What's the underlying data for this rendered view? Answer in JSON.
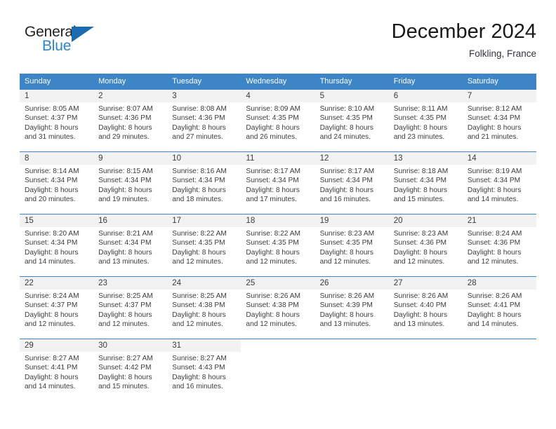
{
  "brand": {
    "name_part1": "General",
    "name_part2": "Blue",
    "triangle_icon": "triangle-icon",
    "color_dark": "#231f20",
    "color_blue": "#2a86c8"
  },
  "header": {
    "title": "December 2024",
    "subtitle": "Folkling, France"
  },
  "theme": {
    "header_bg": "#3d85c6",
    "daynum_bg": "#f2f2f2",
    "text": "#3c3c3c"
  },
  "weekdays": [
    "Sunday",
    "Monday",
    "Tuesday",
    "Wednesday",
    "Thursday",
    "Friday",
    "Saturday"
  ],
  "labels": {
    "sunrise": "Sunrise:",
    "sunset": "Sunset:",
    "daylight": "Daylight:"
  },
  "weeks": [
    [
      {
        "day": "1",
        "sunrise": "Sunrise: 8:05 AM",
        "sunset": "Sunset: 4:37 PM",
        "daylight1": "Daylight: 8 hours",
        "daylight2": "and 31 minutes."
      },
      {
        "day": "2",
        "sunrise": "Sunrise: 8:07 AM",
        "sunset": "Sunset: 4:36 PM",
        "daylight1": "Daylight: 8 hours",
        "daylight2": "and 29 minutes."
      },
      {
        "day": "3",
        "sunrise": "Sunrise: 8:08 AM",
        "sunset": "Sunset: 4:36 PM",
        "daylight1": "Daylight: 8 hours",
        "daylight2": "and 27 minutes."
      },
      {
        "day": "4",
        "sunrise": "Sunrise: 8:09 AM",
        "sunset": "Sunset: 4:35 PM",
        "daylight1": "Daylight: 8 hours",
        "daylight2": "and 26 minutes."
      },
      {
        "day": "5",
        "sunrise": "Sunrise: 8:10 AM",
        "sunset": "Sunset: 4:35 PM",
        "daylight1": "Daylight: 8 hours",
        "daylight2": "and 24 minutes."
      },
      {
        "day": "6",
        "sunrise": "Sunrise: 8:11 AM",
        "sunset": "Sunset: 4:35 PM",
        "daylight1": "Daylight: 8 hours",
        "daylight2": "and 23 minutes."
      },
      {
        "day": "7",
        "sunrise": "Sunrise: 8:12 AM",
        "sunset": "Sunset: 4:34 PM",
        "daylight1": "Daylight: 8 hours",
        "daylight2": "and 21 minutes."
      }
    ],
    [
      {
        "day": "8",
        "sunrise": "Sunrise: 8:14 AM",
        "sunset": "Sunset: 4:34 PM",
        "daylight1": "Daylight: 8 hours",
        "daylight2": "and 20 minutes."
      },
      {
        "day": "9",
        "sunrise": "Sunrise: 8:15 AM",
        "sunset": "Sunset: 4:34 PM",
        "daylight1": "Daylight: 8 hours",
        "daylight2": "and 19 minutes."
      },
      {
        "day": "10",
        "sunrise": "Sunrise: 8:16 AM",
        "sunset": "Sunset: 4:34 PM",
        "daylight1": "Daylight: 8 hours",
        "daylight2": "and 18 minutes."
      },
      {
        "day": "11",
        "sunrise": "Sunrise: 8:17 AM",
        "sunset": "Sunset: 4:34 PM",
        "daylight1": "Daylight: 8 hours",
        "daylight2": "and 17 minutes."
      },
      {
        "day": "12",
        "sunrise": "Sunrise: 8:17 AM",
        "sunset": "Sunset: 4:34 PM",
        "daylight1": "Daylight: 8 hours",
        "daylight2": "and 16 minutes."
      },
      {
        "day": "13",
        "sunrise": "Sunrise: 8:18 AM",
        "sunset": "Sunset: 4:34 PM",
        "daylight1": "Daylight: 8 hours",
        "daylight2": "and 15 minutes."
      },
      {
        "day": "14",
        "sunrise": "Sunrise: 8:19 AM",
        "sunset": "Sunset: 4:34 PM",
        "daylight1": "Daylight: 8 hours",
        "daylight2": "and 14 minutes."
      }
    ],
    [
      {
        "day": "15",
        "sunrise": "Sunrise: 8:20 AM",
        "sunset": "Sunset: 4:34 PM",
        "daylight1": "Daylight: 8 hours",
        "daylight2": "and 14 minutes."
      },
      {
        "day": "16",
        "sunrise": "Sunrise: 8:21 AM",
        "sunset": "Sunset: 4:34 PM",
        "daylight1": "Daylight: 8 hours",
        "daylight2": "and 13 minutes."
      },
      {
        "day": "17",
        "sunrise": "Sunrise: 8:22 AM",
        "sunset": "Sunset: 4:35 PM",
        "daylight1": "Daylight: 8 hours",
        "daylight2": "and 12 minutes."
      },
      {
        "day": "18",
        "sunrise": "Sunrise: 8:22 AM",
        "sunset": "Sunset: 4:35 PM",
        "daylight1": "Daylight: 8 hours",
        "daylight2": "and 12 minutes."
      },
      {
        "day": "19",
        "sunrise": "Sunrise: 8:23 AM",
        "sunset": "Sunset: 4:35 PM",
        "daylight1": "Daylight: 8 hours",
        "daylight2": "and 12 minutes."
      },
      {
        "day": "20",
        "sunrise": "Sunrise: 8:23 AM",
        "sunset": "Sunset: 4:36 PM",
        "daylight1": "Daylight: 8 hours",
        "daylight2": "and 12 minutes."
      },
      {
        "day": "21",
        "sunrise": "Sunrise: 8:24 AM",
        "sunset": "Sunset: 4:36 PM",
        "daylight1": "Daylight: 8 hours",
        "daylight2": "and 12 minutes."
      }
    ],
    [
      {
        "day": "22",
        "sunrise": "Sunrise: 8:24 AM",
        "sunset": "Sunset: 4:37 PM",
        "daylight1": "Daylight: 8 hours",
        "daylight2": "and 12 minutes."
      },
      {
        "day": "23",
        "sunrise": "Sunrise: 8:25 AM",
        "sunset": "Sunset: 4:37 PM",
        "daylight1": "Daylight: 8 hours",
        "daylight2": "and 12 minutes."
      },
      {
        "day": "24",
        "sunrise": "Sunrise: 8:25 AM",
        "sunset": "Sunset: 4:38 PM",
        "daylight1": "Daylight: 8 hours",
        "daylight2": "and 12 minutes."
      },
      {
        "day": "25",
        "sunrise": "Sunrise: 8:26 AM",
        "sunset": "Sunset: 4:38 PM",
        "daylight1": "Daylight: 8 hours",
        "daylight2": "and 12 minutes."
      },
      {
        "day": "26",
        "sunrise": "Sunrise: 8:26 AM",
        "sunset": "Sunset: 4:39 PM",
        "daylight1": "Daylight: 8 hours",
        "daylight2": "and 13 minutes."
      },
      {
        "day": "27",
        "sunrise": "Sunrise: 8:26 AM",
        "sunset": "Sunset: 4:40 PM",
        "daylight1": "Daylight: 8 hours",
        "daylight2": "and 13 minutes."
      },
      {
        "day": "28",
        "sunrise": "Sunrise: 8:26 AM",
        "sunset": "Sunset: 4:41 PM",
        "daylight1": "Daylight: 8 hours",
        "daylight2": "and 14 minutes."
      }
    ],
    [
      {
        "day": "29",
        "sunrise": "Sunrise: 8:27 AM",
        "sunset": "Sunset: 4:41 PM",
        "daylight1": "Daylight: 8 hours",
        "daylight2": "and 14 minutes."
      },
      {
        "day": "30",
        "sunrise": "Sunrise: 8:27 AM",
        "sunset": "Sunset: 4:42 PM",
        "daylight1": "Daylight: 8 hours",
        "daylight2": "and 15 minutes."
      },
      {
        "day": "31",
        "sunrise": "Sunrise: 8:27 AM",
        "sunset": "Sunset: 4:43 PM",
        "daylight1": "Daylight: 8 hours",
        "daylight2": "and 16 minutes."
      },
      {
        "day": "",
        "sunrise": "",
        "sunset": "",
        "daylight1": "",
        "daylight2": ""
      },
      {
        "day": "",
        "sunrise": "",
        "sunset": "",
        "daylight1": "",
        "daylight2": ""
      },
      {
        "day": "",
        "sunrise": "",
        "sunset": "",
        "daylight1": "",
        "daylight2": ""
      },
      {
        "day": "",
        "sunrise": "",
        "sunset": "",
        "daylight1": "",
        "daylight2": ""
      }
    ]
  ]
}
